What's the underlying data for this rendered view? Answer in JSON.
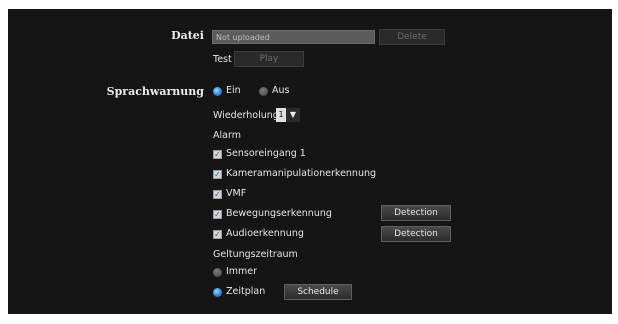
{
  "datei": {
    "heading": "Datei",
    "file_value": "Not uploaded",
    "delete_label": "Delete",
    "test_label": "Test",
    "play_label": "Play"
  },
  "sprachwarnung": {
    "heading": "Sprachwarnung",
    "ein_label": "Ein",
    "aus_label": "Aus",
    "selected": "Ein"
  },
  "wiederholung": {
    "label": "Wiederholung",
    "value": "1",
    "arrow_icon": "triangle-down"
  },
  "alarm": {
    "heading": "Alarm",
    "items": [
      {
        "label": "Sensoreingang 1",
        "checked": true
      },
      {
        "label": "Kameramanipulationerkennung",
        "checked": true
      },
      {
        "label": "VMF",
        "checked": true
      },
      {
        "label": "Bewegungserkennung",
        "checked": true,
        "button": "Detection"
      },
      {
        "label": "Audioerkennung",
        "checked": true,
        "button": "Detection"
      }
    ]
  },
  "geltung": {
    "heading": "Geltungszeitraum",
    "immer_label": "Immer",
    "zeitplan_label": "Zeitplan",
    "selected": "Zeitplan",
    "schedule_label": "Schedule"
  },
  "colors": {
    "panel_bg": "#151515",
    "radio_selected": "#2f7fd6",
    "checkbox_mark": "#205aa8"
  }
}
